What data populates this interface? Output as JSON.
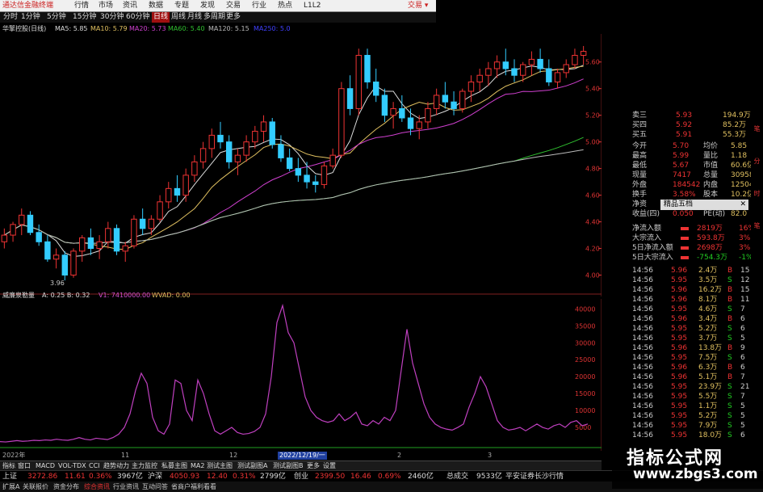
{
  "titlebar": {
    "app_title": "通达信金融终端",
    "menus": [
      "行情",
      "市场",
      "资讯",
      "数据",
      "专题",
      "发现",
      "交易",
      "行业",
      "热点",
      "L1L2"
    ],
    "right": "交易 ▾"
  },
  "toolbar": {
    "periods": [
      "分时",
      "1分钟",
      "5分钟",
      "15分钟",
      "30分钟",
      "60分钟",
      "日线",
      "周线",
      "月线",
      "多周期",
      "更多"
    ],
    "active": "日线"
  },
  "ma_line": {
    "stock": "华擎控股(日线)",
    "items": [
      {
        "label": "MA5: 5.85",
        "color": "#dddddd"
      },
      {
        "label": "MA10: 5.79",
        "color": "#e0c060"
      },
      {
        "label": "MA20: 5.73",
        "color": "#d040d0"
      },
      {
        "label": "MA60: 5.40",
        "color": "#30c030"
      },
      {
        "label": "MA120: 5.15",
        "color": "#bbbbbb"
      },
      {
        "label": "MA250: 5.0",
        "color": "#4040ff"
      }
    ]
  },
  "chart_data": [
    {
      "type": "candlestick",
      "title": "华擎控股(日线)",
      "y_ticks": [
        "5.60",
        "5.40",
        "5.20",
        "5.00",
        "4.80",
        "4.60",
        "4.40",
        "4.20",
        "4.00"
      ],
      "ylim": [
        3.9,
        5.75
      ],
      "low_label": "3.96",
      "candles": [
        [
          4.25,
          4.35,
          4.2,
          4.3
        ],
        [
          4.3,
          4.4,
          4.25,
          4.38
        ],
        [
          4.38,
          4.5,
          4.3,
          4.45
        ],
        [
          4.45,
          4.48,
          4.3,
          4.32
        ],
        [
          4.32,
          4.38,
          4.22,
          4.25
        ],
        [
          4.25,
          4.3,
          4.1,
          4.12
        ],
        [
          4.12,
          4.2,
          4.05,
          4.15
        ],
        [
          4.15,
          4.18,
          3.96,
          4.0
        ],
        [
          4.0,
          4.2,
          3.98,
          4.18
        ],
        [
          4.18,
          4.3,
          4.1,
          4.28
        ],
        [
          4.28,
          4.35,
          4.15,
          4.2
        ],
        [
          4.2,
          4.3,
          4.12,
          4.25
        ],
        [
          4.25,
          4.4,
          4.2,
          4.35
        ],
        [
          4.35,
          4.38,
          4.15,
          4.18
        ],
        [
          4.18,
          4.25,
          4.1,
          4.22
        ],
        [
          4.22,
          4.45,
          4.2,
          4.42
        ],
        [
          4.42,
          4.5,
          4.3,
          4.35
        ],
        [
          4.35,
          4.45,
          4.3,
          4.42
        ],
        [
          4.42,
          4.6,
          4.4,
          4.55
        ],
        [
          4.55,
          4.7,
          4.5,
          4.65
        ],
        [
          4.65,
          4.75,
          4.55,
          4.6
        ],
        [
          4.6,
          4.8,
          4.55,
          4.75
        ],
        [
          4.75,
          4.9,
          4.7,
          4.85
        ],
        [
          4.85,
          5.0,
          4.8,
          4.95
        ],
        [
          4.95,
          5.1,
          4.88,
          5.05
        ],
        [
          5.05,
          5.15,
          4.95,
          5.0
        ],
        [
          5.0,
          5.05,
          4.8,
          4.85
        ],
        [
          4.85,
          4.95,
          4.75,
          4.9
        ],
        [
          4.9,
          5.05,
          4.85,
          5.0
        ],
        [
          5.0,
          5.12,
          4.95,
          5.08
        ],
        [
          5.08,
          5.2,
          5.0,
          5.15
        ],
        [
          5.15,
          5.18,
          4.95,
          4.98
        ],
        [
          4.98,
          5.05,
          4.85,
          4.88
        ],
        [
          4.88,
          4.95,
          4.78,
          4.8
        ],
        [
          4.8,
          4.88,
          4.7,
          4.75
        ],
        [
          4.75,
          4.85,
          4.65,
          4.7
        ],
        [
          4.7,
          4.75,
          4.62,
          4.68
        ],
        [
          4.68,
          4.85,
          4.65,
          4.82
        ],
        [
          4.82,
          4.95,
          4.8,
          4.9
        ],
        [
          4.9,
          5.45,
          4.88,
          5.4
        ],
        [
          5.4,
          5.5,
          5.2,
          5.25
        ],
        [
          5.25,
          5.7,
          5.2,
          5.65
        ],
        [
          5.65,
          5.7,
          5.4,
          5.45
        ],
        [
          5.45,
          5.55,
          5.3,
          5.35
        ],
        [
          5.35,
          5.4,
          5.15,
          5.2
        ],
        [
          5.2,
          5.3,
          5.1,
          5.25
        ],
        [
          5.25,
          5.35,
          5.15,
          5.18
        ],
        [
          5.18,
          5.25,
          5.05,
          5.1
        ],
        [
          5.1,
          5.2,
          5.02,
          5.15
        ],
        [
          5.15,
          5.3,
          5.1,
          5.25
        ],
        [
          5.25,
          5.4,
          5.2,
          5.35
        ],
        [
          5.35,
          5.45,
          5.25,
          5.3
        ],
        [
          5.3,
          5.38,
          5.2,
          5.25
        ],
        [
          5.25,
          5.4,
          5.22,
          5.38
        ],
        [
          5.38,
          5.5,
          5.3,
          5.45
        ],
        [
          5.45,
          5.55,
          5.38,
          5.5
        ],
        [
          5.5,
          5.6,
          5.42,
          5.55
        ],
        [
          5.55,
          5.65,
          5.48,
          5.6
        ],
        [
          5.6,
          5.7,
          5.5,
          5.55
        ],
        [
          5.55,
          5.62,
          5.45,
          5.5
        ],
        [
          5.5,
          5.6,
          5.45,
          5.58
        ],
        [
          5.58,
          5.68,
          5.5,
          5.62
        ],
        [
          5.62,
          5.7,
          5.52,
          5.55
        ],
        [
          5.55,
          5.62,
          5.42,
          5.45
        ],
        [
          5.45,
          5.55,
          5.4,
          5.52
        ],
        [
          5.52,
          5.62,
          5.48,
          5.58
        ],
        [
          5.58,
          5.7,
          5.55,
          5.65
        ],
        [
          5.65,
          5.72,
          5.58,
          5.68
        ]
      ]
    },
    {
      "type": "line",
      "title": "威廉泉勒量",
      "params": "A: 0.25  B: 0.32",
      "v1_label": "V1: 7410000.00",
      "wvad_label": "WVAD: 0.00",
      "y_ticks": [
        "40000",
        "35000",
        "30000",
        "25000",
        "20000",
        "15000",
        "10000",
        "5000"
      ],
      "ylim": [
        0,
        42000
      ],
      "values": [
        800,
        700,
        900,
        1100,
        900,
        1000,
        1200,
        1100,
        1300,
        1200,
        1500,
        1300,
        1200,
        1500,
        2000,
        1500,
        1300,
        1800,
        1600,
        1400,
        2000,
        3000,
        5000,
        9000,
        16000,
        21000,
        18000,
        8000,
        4000,
        3000,
        6000,
        19000,
        18000,
        10000,
        7000,
        19000,
        15000,
        9000,
        4000,
        3000,
        4000,
        5000,
        3500,
        3000,
        3200,
        3800,
        5000,
        9000,
        20000,
        36000,
        41000,
        33000,
        30000,
        22000,
        14000,
        10000,
        8000,
        7000,
        6500,
        7000,
        9000,
        7000,
        8000,
        9500,
        6000,
        5500,
        7000,
        6000,
        8000,
        7000,
        10000,
        22000,
        34000,
        24000,
        18000,
        12000,
        8000,
        6000,
        5000,
        4500,
        4200,
        5000,
        6000,
        11000,
        15000,
        20000,
        17000,
        12000,
        7000,
        5000,
        4200,
        4500,
        5000,
        4000,
        5000,
        6000,
        5000,
        4500,
        5500,
        6000,
        5000,
        6500,
        7000,
        5500,
        6000
      ]
    }
  ],
  "axis_marks": {
    "date_2022": "2022年",
    "month_11": "11",
    "month_12": "12",
    "date_sel": "2022/12/19/一",
    "month_2": "2",
    "month_3": "3"
  },
  "quote_panel": {
    "levels": [
      {
        "label": "卖三",
        "price": "5.93",
        "vol": "194.9万"
      },
      {
        "label": "买四",
        "price": "5.92",
        "vol": "85.2万"
      },
      {
        "label": "买五",
        "price": "5.91",
        "vol": "55.3万"
      }
    ],
    "stats": [
      {
        "l1": "今开",
        "v1": "5.70",
        "l2": "均价",
        "v2": "5.85"
      },
      {
        "l1": "最高",
        "v1": "5.99",
        "l2": "量比",
        "v2": "1.18"
      },
      {
        "l1": "最低",
        "v1": "5.67",
        "l2": "市值",
        "v2": "60.6亿"
      },
      {
        "l1": "现量",
        "v1": "7417",
        "l2": "总量",
        "v2": "309584"
      },
      {
        "l1": "外盘",
        "v1": "184542",
        "l2": "内盘",
        "v2": "125042"
      },
      {
        "l1": "换手",
        "v1": "3.58%",
        "l2": "股本",
        "v2": "10.2亿"
      },
      {
        "l1": "净资",
        "v1": "",
        "l2": "",
        "v2": ""
      },
      {
        "l1": "收益(四)",
        "v1": "0.050",
        "l2": "PE(动)",
        "v2": "82.0"
      }
    ],
    "popup": "精品五档",
    "flows": [
      {
        "label": "净流入额",
        "value": "2819万",
        "pct": "16%"
      },
      {
        "label": "大宗流入",
        "value": "593.8万",
        "pct": "3%"
      },
      {
        "label": "5日净流入额",
        "value": "2698万",
        "pct": "3%"
      },
      {
        "label": "5日大宗流入",
        "value": "-754.3万",
        "pct": "-1%"
      }
    ],
    "ticks": [
      {
        "t": "14:56",
        "p": "5.96",
        "v": "2.4万",
        "s": "B",
        "n": "15"
      },
      {
        "t": "14:56",
        "p": "5.95",
        "v": "3.5万",
        "s": "S",
        "n": "12"
      },
      {
        "t": "14:56",
        "p": "5.96",
        "v": "16.2万",
        "s": "B",
        "n": "15"
      },
      {
        "t": "14:56",
        "p": "5.96",
        "v": "8.1万",
        "s": "B",
        "n": "11"
      },
      {
        "t": "14:56",
        "p": "5.95",
        "v": "4.6万",
        "s": "S",
        "n": "7"
      },
      {
        "t": "14:56",
        "p": "5.96",
        "v": "3.4万",
        "s": "B",
        "n": "6"
      },
      {
        "t": "14:56",
        "p": "5.95",
        "v": "5.2万",
        "s": "S",
        "n": "6"
      },
      {
        "t": "14:56",
        "p": "5.95",
        "v": "3.7万",
        "s": "S",
        "n": "5"
      },
      {
        "t": "14:56",
        "p": "5.96",
        "v": "13.8万",
        "s": "B",
        "n": "9"
      },
      {
        "t": "14:56",
        "p": "5.95",
        "v": "7.5万",
        "s": "S",
        "n": "6"
      },
      {
        "t": "14:56",
        "p": "5.96",
        "v": "6.3万",
        "s": "B",
        "n": "6"
      },
      {
        "t": "14:56",
        "p": "5.96",
        "v": "5.1万",
        "s": "B",
        "n": "7"
      },
      {
        "t": "14:56",
        "p": "5.95",
        "v": "23.9万",
        "s": "S",
        "n": "21"
      },
      {
        "t": "14:56",
        "p": "5.95",
        "v": "5.5万",
        "s": "S",
        "n": "7"
      },
      {
        "t": "14:56",
        "p": "5.95",
        "v": "1.1万",
        "s": "S",
        "n": "5"
      },
      {
        "t": "14:56",
        "p": "5.95",
        "v": "5.2万",
        "s": "S",
        "n": "5"
      },
      {
        "t": "14:56",
        "p": "5.95",
        "v": "7.9万",
        "s": "S",
        "n": "5"
      },
      {
        "t": "14:56",
        "p": "5.95",
        "v": "18.0万",
        "s": "S",
        "n": "6"
      }
    ]
  },
  "tabs": [
    "指标",
    "窗口",
    "MACD",
    "VOL-TDX",
    "CCI",
    "趋势动力",
    "主力监控",
    "私募主图",
    "MA2",
    "测试主图",
    "测试副图A",
    "测试副图B",
    "更多",
    "设置"
  ],
  "tabs2": [
    "扩展A",
    "关联报价",
    "资金分布",
    "综合资讯",
    "行业资讯",
    "互动问答",
    "省商户福利看看"
  ],
  "status": [
    {
      "label": "上证",
      "color": "#ddd"
    },
    {
      "label": "3272.86",
      "color": "#e33"
    },
    {
      "label": "11.61",
      "color": "#e33"
    },
    {
      "label": "0.36%",
      "color": "#e33"
    },
    {
      "label": "3967亿",
      "color": "#ddd"
    },
    {
      "label": "沪深",
      "color": "#ddd"
    },
    {
      "label": "4050.93",
      "color": "#e33"
    },
    {
      "label": "12.40",
      "color": "#e33"
    },
    {
      "label": "0.31%",
      "color": "#e33"
    },
    {
      "label": "2799亿",
      "color": "#ddd"
    },
    {
      "label": "创业",
      "color": "#ddd"
    },
    {
      "label": "2399.50",
      "color": "#e33"
    },
    {
      "label": "16.46",
      "color": "#e33"
    },
    {
      "label": "0.69%",
      "color": "#e33"
    },
    {
      "label": "2460亿",
      "color": "#ddd"
    },
    {
      "label": "总成交",
      "color": "#ddd"
    },
    {
      "label": "9533亿",
      "color": "#ddd"
    },
    {
      "label": "平安证券长沙行情",
      "color": "#ddd"
    }
  ],
  "watermark": {
    "line1": "指标公式网",
    "line2": "www.zbgs3.com"
  },
  "side_tabs": [
    "笔",
    "分",
    "时",
    "笔"
  ]
}
